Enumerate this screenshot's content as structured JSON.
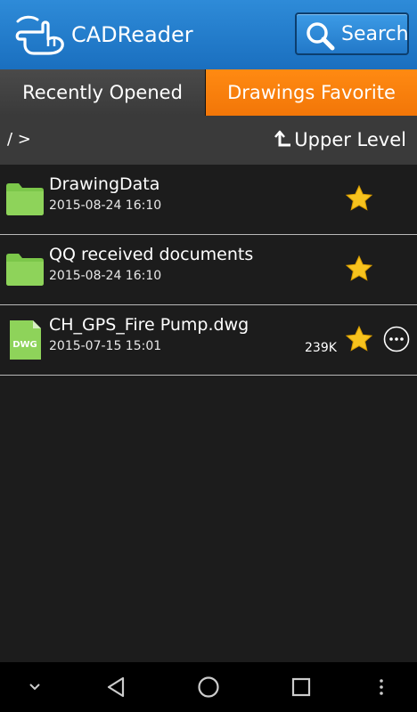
{
  "header": {
    "app_title": "CADReader",
    "search_label": "Search",
    "accent_color": "#1a6fbf"
  },
  "tabs": [
    {
      "label": "Recently Opened",
      "active": false
    },
    {
      "label": "Drawings Favorite",
      "active": true,
      "color": "#f27608"
    }
  ],
  "pathbar": {
    "path": "/ >",
    "upper_level_label": "Upper Level"
  },
  "files": [
    {
      "name": "DrawingData",
      "date": "2015-08-24 16:10",
      "type": "folder",
      "favorite": true
    },
    {
      "name": "QQ received documents",
      "date": "2015-08-24 16:10",
      "type": "folder",
      "favorite": true
    },
    {
      "name": "CH_GPS_Fire Pump.dwg",
      "date": "2015-07-15 15:01",
      "size": "239K",
      "type": "dwg",
      "file_badge": "DWG",
      "favorite": true
    }
  ],
  "icons": {
    "logo": "hand-pointer-icon",
    "search": "magnifier-icon",
    "upper": "upper-level-arrow-icon",
    "folder": "folder-icon",
    "dwg": "dwg-file-icon",
    "star": "star-icon",
    "more": "more-options-icon"
  },
  "navbar": [
    "chevron-down-icon",
    "back-icon",
    "home-icon",
    "recents-icon",
    "menu-dots-icon"
  ]
}
